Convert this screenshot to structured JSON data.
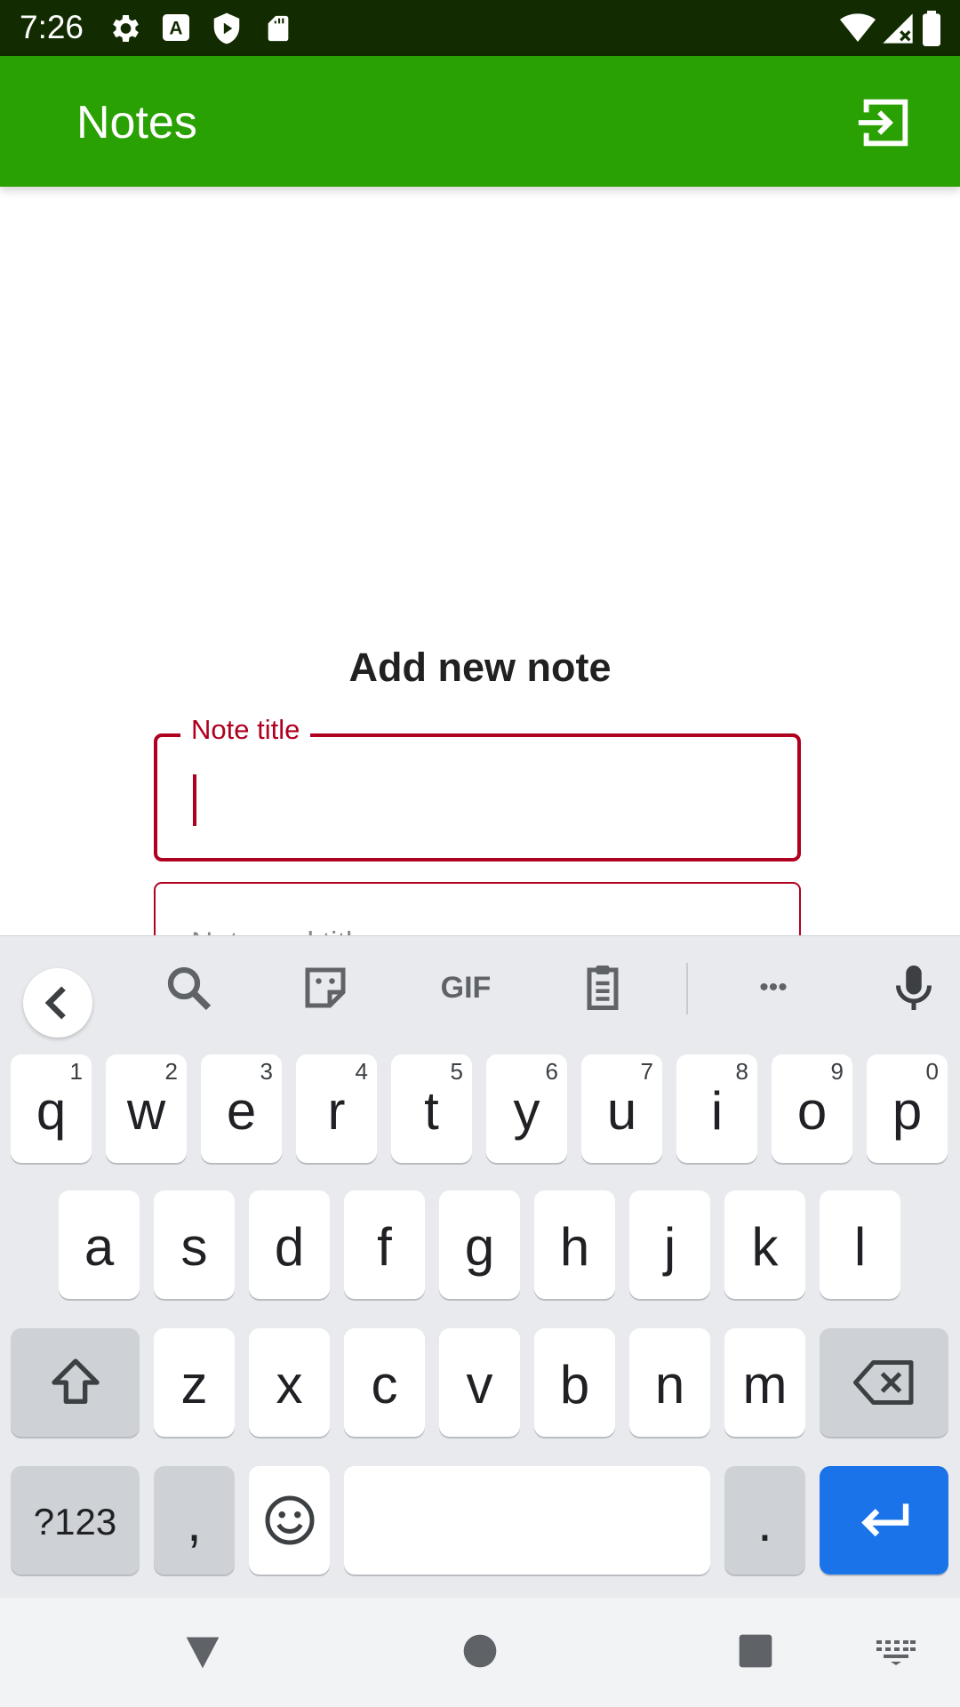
{
  "status_bar": {
    "time": "7:26",
    "left_icons": [
      "settings-icon",
      "accessibility-a-icon",
      "play-protect-icon",
      "sd-card-icon"
    ],
    "right_icons": [
      "wifi-icon",
      "signal-icon",
      "battery-icon"
    ]
  },
  "app_bar": {
    "title": "Notes",
    "action_icon": "logout-icon",
    "color": "#29a102"
  },
  "form": {
    "heading": "Add new note",
    "title_field": {
      "label": "Note title",
      "value": ""
    },
    "body_field": {
      "placeholder": "Note and title"
    },
    "error_color": "#b00020"
  },
  "keyboard": {
    "toolbar": [
      "back-icon",
      "search-icon",
      "sticker-icon",
      "gif-icon",
      "clipboard-icon",
      "more-icon",
      "mic-icon"
    ],
    "gif_label": "GIF",
    "more_label": "•••",
    "row1": [
      {
        "k": "q",
        "h": "1"
      },
      {
        "k": "w",
        "h": "2"
      },
      {
        "k": "e",
        "h": "3"
      },
      {
        "k": "r",
        "h": "4"
      },
      {
        "k": "t",
        "h": "5"
      },
      {
        "k": "y",
        "h": "6"
      },
      {
        "k": "u",
        "h": "7"
      },
      {
        "k": "i",
        "h": "8"
      },
      {
        "k": "o",
        "h": "9"
      },
      {
        "k": "p",
        "h": "0"
      }
    ],
    "row2": [
      "a",
      "s",
      "d",
      "f",
      "g",
      "h",
      "j",
      "k",
      "l"
    ],
    "row3": [
      "z",
      "x",
      "c",
      "v",
      "b",
      "n",
      "m"
    ],
    "symbols_label": "?123",
    "comma_label": ",",
    "period_label": ".",
    "enter_color": "#1a73e8"
  },
  "nav_bar": {
    "icons": [
      "back-triangle-icon",
      "home-circle-icon",
      "recents-square-icon",
      "keyboard-switch-icon"
    ]
  }
}
